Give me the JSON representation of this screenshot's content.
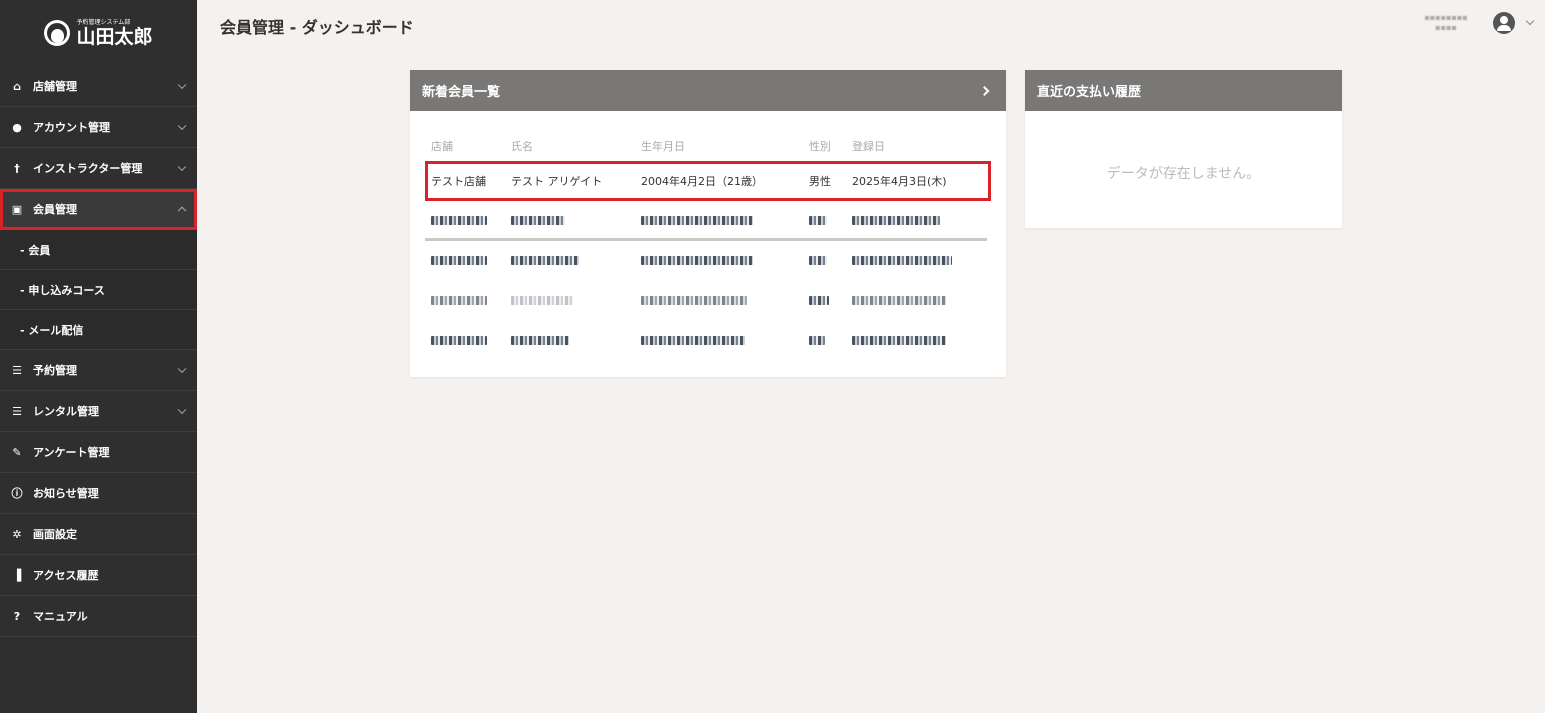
{
  "app": {
    "logo_sub": "予約管理システム部",
    "logo_main": "山田太郎"
  },
  "sidebar": {
    "items": [
      {
        "label": "店舗管理",
        "icon": "home-icon"
      },
      {
        "label": "アカウント管理",
        "icon": "user-icon"
      },
      {
        "label": "インストラクター管理",
        "icon": "instructor-icon"
      },
      {
        "label": "会員管理",
        "icon": "member-card-icon"
      },
      {
        "label": "予約管理",
        "icon": "reservation-icon"
      },
      {
        "label": "レンタル管理",
        "icon": "rental-icon"
      },
      {
        "label": "アンケート管理",
        "icon": "pen-icon"
      },
      {
        "label": "お知らせ管理",
        "icon": "info-icon"
      },
      {
        "label": "画面設定",
        "icon": "gear-icon"
      },
      {
        "label": "アクセス履歴",
        "icon": "bar-chart-icon"
      },
      {
        "label": "マニュアル",
        "icon": "question-icon"
      }
    ],
    "sub_items": [
      {
        "label": "- 会員"
      },
      {
        "label": "- 申し込みコース"
      },
      {
        "label": "- メール配信"
      }
    ]
  },
  "header": {
    "title": "会員管理 - ダッシュボード"
  },
  "members_card": {
    "title": "新着会員一覧",
    "columns": [
      "店舗",
      "氏名",
      "生年月日",
      "性別",
      "登録日"
    ],
    "highlight_row": {
      "store": "テスト店舗",
      "name": "テスト アリゲイト",
      "birthday": "2004年4月2日（21歳）",
      "gender": "男性",
      "registered": "2025年4月3日(木)"
    }
  },
  "history_card": {
    "title": "直近の支払い履歴",
    "empty_message": "データが存在しません。"
  },
  "colors": {
    "sidebar_bg": "#2f2f2f",
    "card_header_bg": "#7a7876",
    "highlight": "#d9222a",
    "page_bg": "#f4f1ee"
  }
}
